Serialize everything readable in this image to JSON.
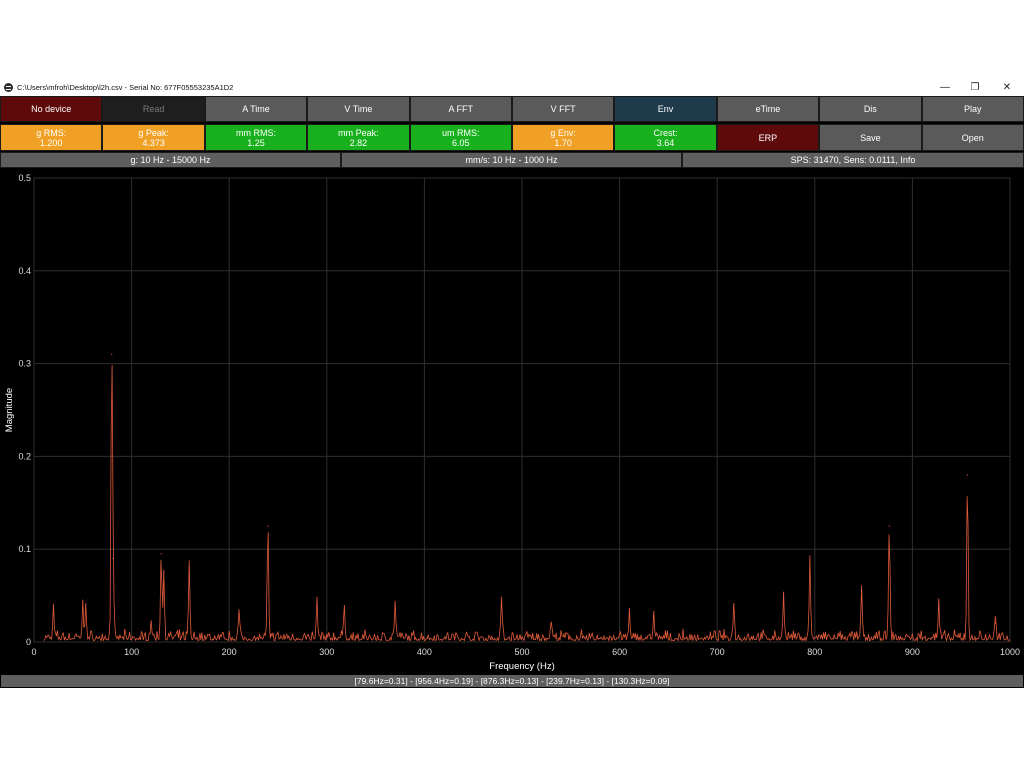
{
  "window": {
    "title": "C:\\Users\\mfroh\\Desktop\\l2h.csv - Serial No: 677F05553235A1D2",
    "minimize_glyph": "—",
    "restore_glyph": "❐",
    "close_glyph": "✕"
  },
  "toolbar": {
    "row1": [
      {
        "label": "No device",
        "color": "#5e0a0a",
        "text_color": "#ffffff"
      },
      {
        "label": "Read",
        "color": "#1e1e1e",
        "text_color": "#7a7a7a"
      },
      {
        "label": "A Time",
        "color": "#5a5a5a",
        "text_color": "#ffffff"
      },
      {
        "label": "V Time",
        "color": "#5a5a5a",
        "text_color": "#ffffff"
      },
      {
        "label": "A FFT",
        "color": "#5a5a5a",
        "text_color": "#ffffff"
      },
      {
        "label": "V FFT",
        "color": "#5a5a5a",
        "text_color": "#ffffff"
      },
      {
        "label": "Env",
        "color": "#1f3a4a",
        "text_color": "#ffffff"
      },
      {
        "label": "eTime",
        "color": "#5a5a5a",
        "text_color": "#ffffff"
      },
      {
        "label": "Dis",
        "color": "#5a5a5a",
        "text_color": "#ffffff"
      },
      {
        "label": "Play",
        "color": "#5a5a5a",
        "text_color": "#ffffff"
      }
    ],
    "row2": [
      {
        "label": "g RMS:",
        "value": "1.200",
        "color": "#f0a024"
      },
      {
        "label": "g Peak:",
        "value": "4.373",
        "color": "#f0a024"
      },
      {
        "label": "mm RMS:",
        "value": "1.25",
        "color": "#18b01c"
      },
      {
        "label": "mm Peak:",
        "value": "2.82",
        "color": "#18b01c"
      },
      {
        "label": "um RMS:",
        "value": "6.05",
        "color": "#18b01c"
      },
      {
        "label": "g Env:",
        "value": "1.70",
        "color": "#f0a024"
      },
      {
        "label": "Crest:",
        "value": "3.64",
        "color": "#18b01c"
      },
      {
        "label": "ERP",
        "value": "",
        "color": "#5e0a0a"
      },
      {
        "label": "Save",
        "value": "",
        "color": "#5a5a5a"
      },
      {
        "label": "Open",
        "value": "",
        "color": "#5a5a5a"
      }
    ],
    "row3": [
      {
        "label": "g: 10 Hz - 15000 Hz"
      },
      {
        "label": "mm/s: 10 Hz - 1000 Hz"
      },
      {
        "label": "SPS: 31470, Sens: 0.0111, Info"
      }
    ]
  },
  "status": {
    "peaks_text": "[79.6Hz=0.31] - [956.4Hz=0.19] - [876.3Hz=0.13] - [239.7Hz=0.13] - [130.3Hz=0.09]"
  },
  "chart_data": {
    "type": "line",
    "xlabel": "Frequency (Hz)",
    "ylabel": "Magnitude",
    "xlim": [
      0,
      1000
    ],
    "ylim": [
      0,
      0.5
    ],
    "x_ticks": [
      0,
      100,
      200,
      300,
      400,
      500,
      600,
      700,
      800,
      900,
      1000
    ],
    "y_ticks": [
      0,
      0.1,
      0.2,
      0.3,
      0.4,
      0.5
    ],
    "grid": true,
    "line_color": "#e05a3a",
    "background": "#000000",
    "x_start": 10,
    "noise_level": 0.008,
    "peaks": [
      {
        "x": 20,
        "y": 0.03
      },
      {
        "x": 50,
        "y": 0.035
      },
      {
        "x": 53,
        "y": 0.04
      },
      {
        "x": 79.6,
        "y": 0.31
      },
      {
        "x": 81,
        "y": 0.09
      },
      {
        "x": 120,
        "y": 0.02
      },
      {
        "x": 130.3,
        "y": 0.095
      },
      {
        "x": 133,
        "y": 0.075
      },
      {
        "x": 159,
        "y": 0.08
      },
      {
        "x": 210,
        "y": 0.03
      },
      {
        "x": 239.7,
        "y": 0.125
      },
      {
        "x": 290,
        "y": 0.04
      },
      {
        "x": 318,
        "y": 0.035
      },
      {
        "x": 370,
        "y": 0.04
      },
      {
        "x": 479,
        "y": 0.045
      },
      {
        "x": 530,
        "y": 0.02
      },
      {
        "x": 610,
        "y": 0.025
      },
      {
        "x": 635,
        "y": 0.028
      },
      {
        "x": 717,
        "y": 0.04
      },
      {
        "x": 768,
        "y": 0.052
      },
      {
        "x": 795,
        "y": 0.088
      },
      {
        "x": 848,
        "y": 0.055
      },
      {
        "x": 876.3,
        "y": 0.125
      },
      {
        "x": 927,
        "y": 0.04
      },
      {
        "x": 956.4,
        "y": 0.18
      },
      {
        "x": 985,
        "y": 0.02
      }
    ]
  }
}
